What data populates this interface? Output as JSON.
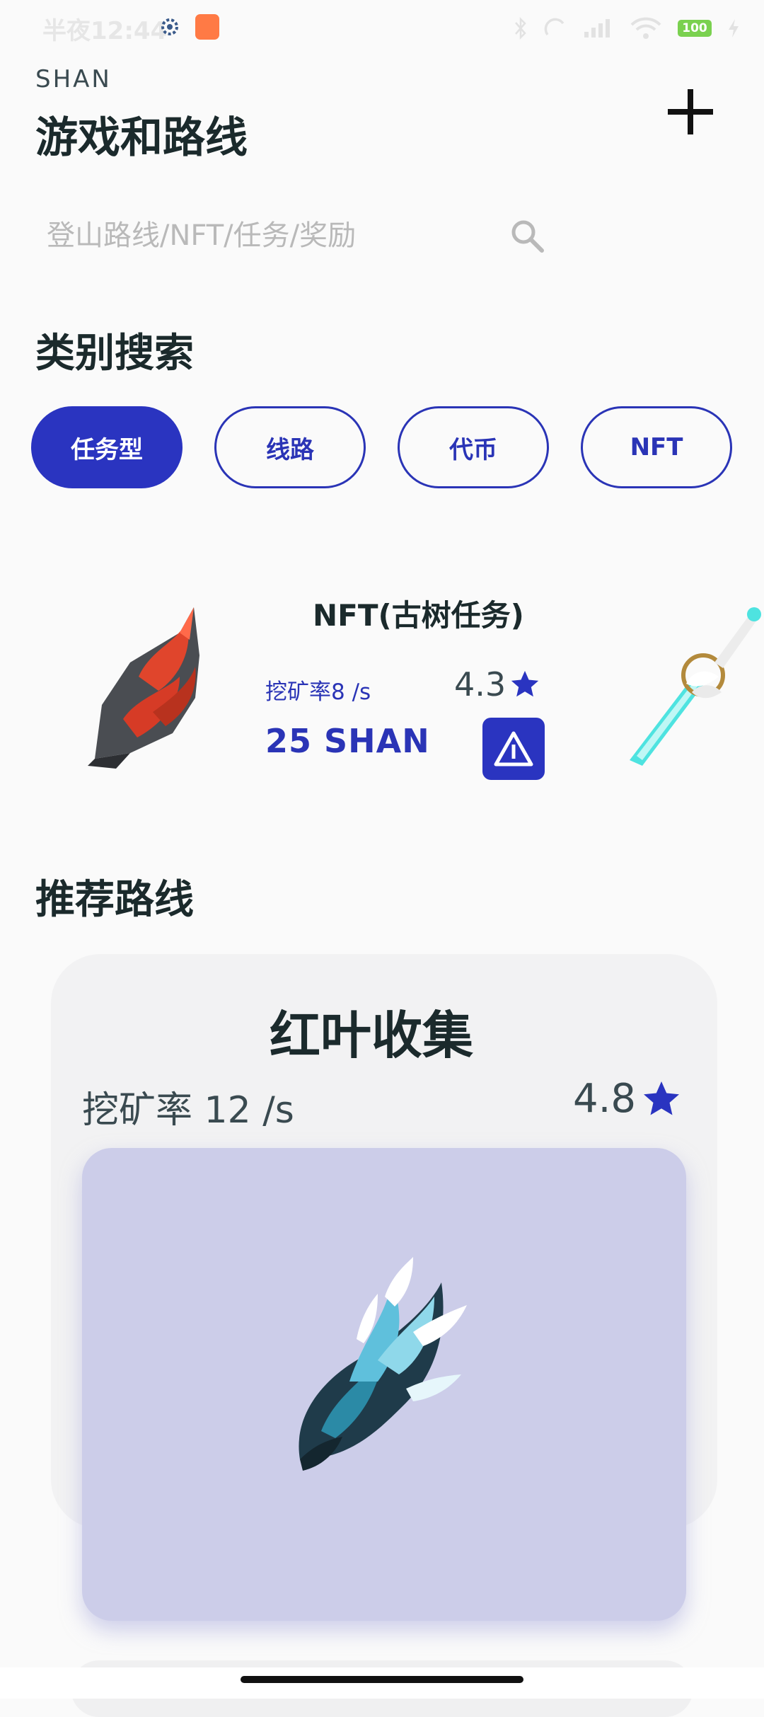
{
  "status_bar": {
    "time": "半夜12:44",
    "battery": "100"
  },
  "header": {
    "brand": "SHAN",
    "title": "游戏和路线",
    "add_icon": "plus-icon"
  },
  "search": {
    "placeholder": "登山路线/NFT/任务/奖励",
    "icon": "search-icon"
  },
  "category": {
    "title": "类别搜索",
    "chips": [
      {
        "label": "任务型",
        "active": true
      },
      {
        "label": "线路",
        "active": false
      },
      {
        "label": "代币",
        "active": false
      },
      {
        "label": "NFT",
        "active": false
      }
    ]
  },
  "nft_card": {
    "title": "NFT(古树任务)",
    "mining_rate": "挖矿率8 /s",
    "rating": "4.3",
    "price": "25 SHAN",
    "action_icon": "warning-triangle-icon"
  },
  "recommended": {
    "title": "推荐路线",
    "route": {
      "name": "红叶收集",
      "mining_rate": "挖矿率 12 /s",
      "rating": "4.8"
    }
  },
  "colors": {
    "accent": "#2a34c0",
    "star": "#2a34c0",
    "image_bg": "#cccde9"
  }
}
